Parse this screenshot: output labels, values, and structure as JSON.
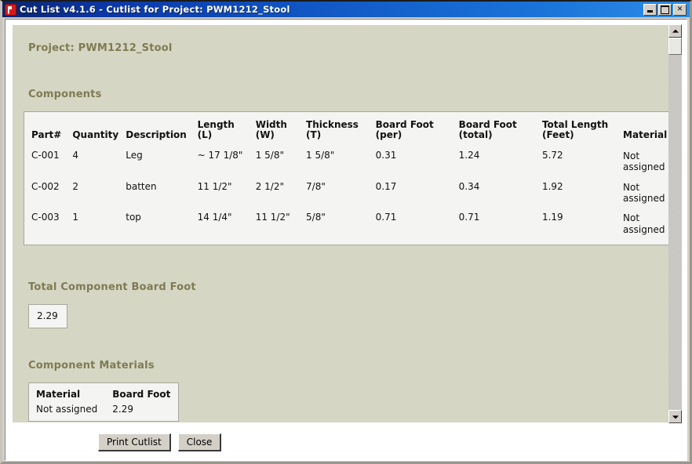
{
  "window": {
    "title": "Cut List v4.1.6 -  Cutlist for Project: PWM1212_Stool",
    "icon": "cutlist-app-icon",
    "controls": {
      "minimize": "_",
      "maximize": "□",
      "close": "✕"
    }
  },
  "content": {
    "project_heading": "Project: PWM1212_Stool",
    "components_heading": "Components",
    "total_bf_heading": "Total Component Board Foot",
    "total_bf_value": "2.29",
    "materials_heading": "Component Materials"
  },
  "components_table": {
    "headers": [
      "Part#",
      "Quantity",
      "Description",
      "Length\n(L)",
      "Width\n(W)",
      "Thickness\n(T)",
      "Board Foot\n(per)",
      "Board Foot\n(total)",
      "Total Length\n(Feet)",
      "Material"
    ],
    "rows": [
      {
        "part": "C-001",
        "quantity": "4",
        "description": "Leg",
        "length": "~ 17 1/8\"",
        "width": "1 5/8\"",
        "thickness": "1 5/8\"",
        "bf_per": "0.31",
        "bf_total": "1.24",
        "total_length": "5.72",
        "material": "Not assigned"
      },
      {
        "part": "C-002",
        "quantity": "2",
        "description": "batten",
        "length": "11 1/2\"",
        "width": "2 1/2\"",
        "thickness": "7/8\"",
        "bf_per": "0.17",
        "bf_total": "0.34",
        "total_length": "1.92",
        "material": "Not assigned"
      },
      {
        "part": "C-003",
        "quantity": "1",
        "description": "top",
        "length": "14 1/4\"",
        "width": "11 1/2\"",
        "thickness": "5/8\"",
        "bf_per": "0.71",
        "bf_total": "0.71",
        "total_length": "1.19",
        "material": "Not assigned"
      }
    ]
  },
  "materials_table": {
    "headers": [
      "Material",
      "Board Foot"
    ],
    "rows": [
      {
        "material": "Not assigned",
        "board_foot": "2.29"
      }
    ]
  },
  "buttons": {
    "print": "Print Cutlist",
    "close": "Close"
  },
  "colors": {
    "background": "#d5d6c3",
    "heading": "#7e7b54",
    "table_background": "#f4f4f2",
    "titlebar_start": "#0a246a",
    "titlebar_end": "#2e8ce6",
    "app_icon": "#d61a1a"
  }
}
